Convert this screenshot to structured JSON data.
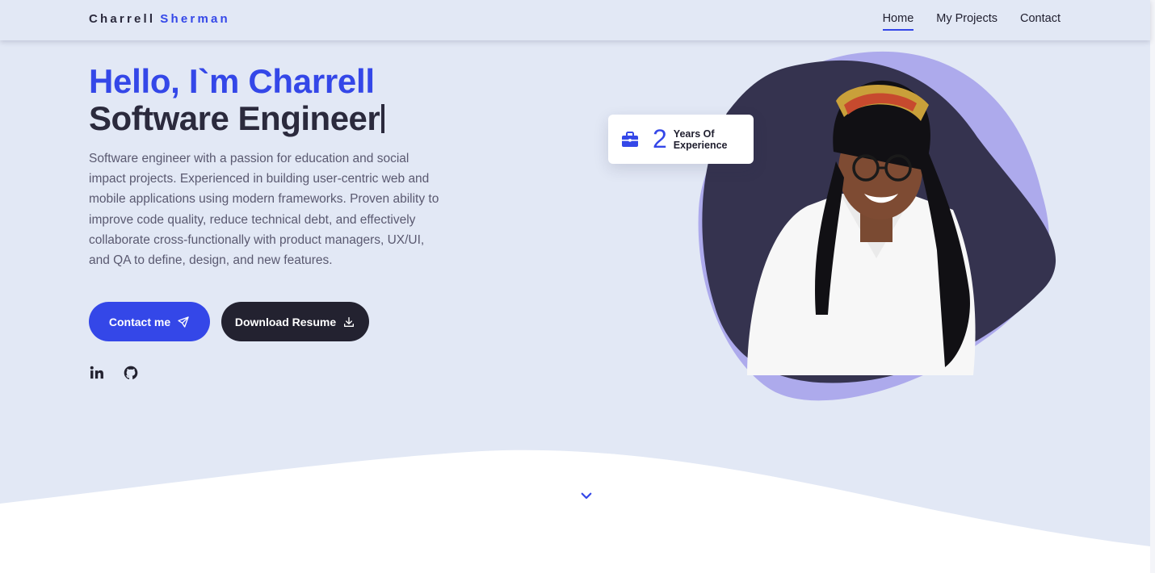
{
  "nav": {
    "brand_first": "Charrell",
    "brand_last": "Sherman",
    "links": [
      {
        "label": "Home",
        "active": true
      },
      {
        "label": "My Projects",
        "active": false
      },
      {
        "label": "Contact",
        "active": false
      }
    ]
  },
  "hero": {
    "greeting": "Hello, I`m Charrell",
    "role": "Software Engineer",
    "description": "Software engineer with a passion for education and social impact projects. Experienced in building user-centric web and mobile applications using modern frameworks. Proven ability to improve code quality, reduce technical debt, and effectively collaborate cross-functionally with product managers, UX/UI, and QA to define, design, and new features.",
    "contact_label": "Contact me",
    "contact_icon": "send-icon",
    "resume_label": "Download Resume",
    "resume_icon": "download-icon",
    "social": [
      "linkedin-icon",
      "github-icon"
    ]
  },
  "experience": {
    "icon": "briefcase-icon",
    "number": "2",
    "label_line1": "Years Of",
    "label_line2": "Experience"
  },
  "scroll": {
    "icon": "chevron-down-icon"
  },
  "colors": {
    "accent": "#3447e8",
    "dark": "#2b2a3d",
    "background": "#e2e8f5",
    "blob_light": "#adaaec",
    "blob_dark": "#35334f"
  }
}
